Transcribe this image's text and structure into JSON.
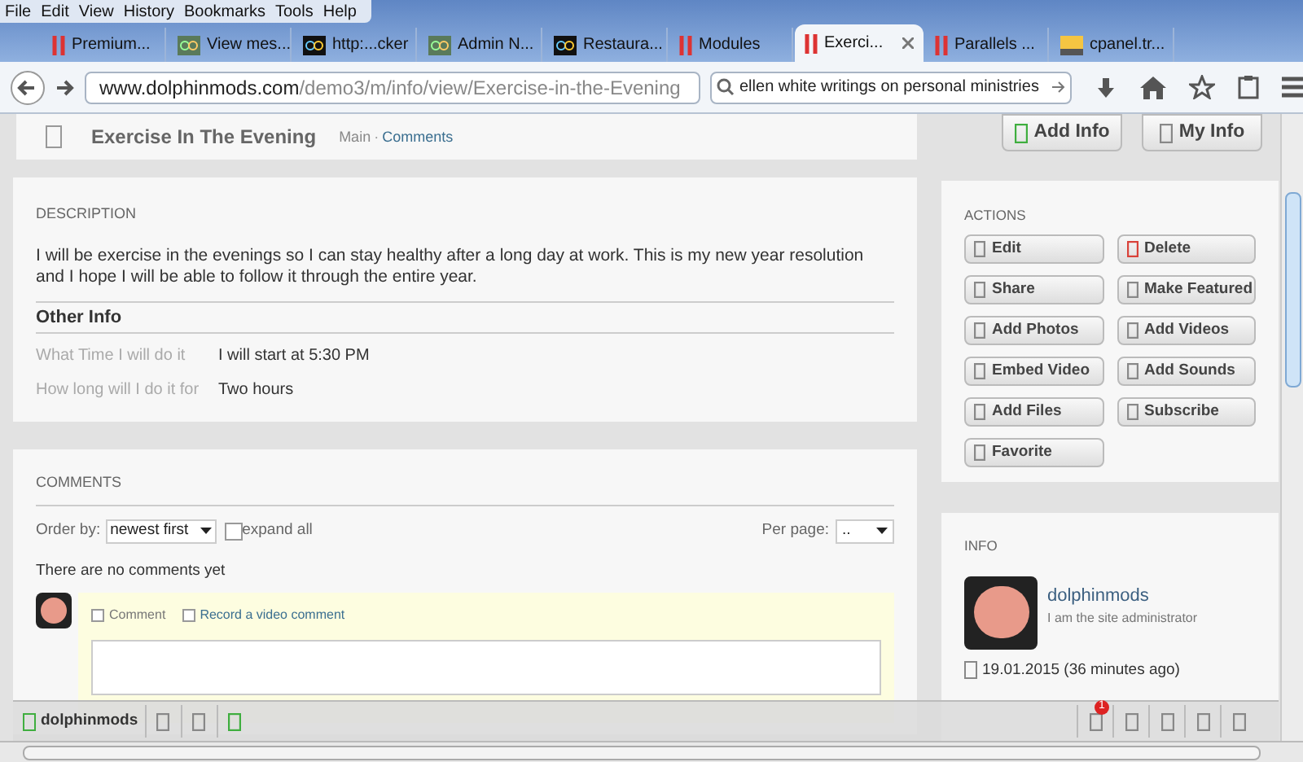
{
  "menu": [
    "File",
    "Edit",
    "View",
    "History",
    "Bookmarks",
    "Tools",
    "Help"
  ],
  "tabs": [
    {
      "label": "Premium...",
      "selected": false,
      "kind": "bars"
    },
    {
      "label": "View mes...",
      "selected": false,
      "kind": "loop"
    },
    {
      "label": "http:...cker",
      "selected": false,
      "kind": "loop-dark"
    },
    {
      "label": "Admin N...",
      "selected": false,
      "kind": "loop"
    },
    {
      "label": "Restaura...",
      "selected": false,
      "kind": "loop-dark"
    },
    {
      "label": "Modules",
      "selected": false,
      "kind": "bars"
    },
    {
      "label": "Exerci...",
      "selected": true,
      "kind": "bars"
    },
    {
      "label": "Parallels ...",
      "selected": false,
      "kind": "bars"
    },
    {
      "label": "cpanel.tr...",
      "selected": false,
      "kind": "cpanel"
    }
  ],
  "address": {
    "host": "www.dolphinmods.com",
    "path": "/demo3/m/info/view/Exercise-in-the-Evening"
  },
  "search": {
    "value": "ellen white writings on personal ministries"
  },
  "page_header": {
    "title": "Exercise In The Evening",
    "separator": "·",
    "breadcrumb": [
      {
        "label": "Main",
        "link": false
      },
      {
        "label": "Comments",
        "link": true
      }
    ],
    "buttons": [
      {
        "label": "Add Info",
        "color": "#3fae3f"
      },
      {
        "label": "My Info",
        "color": "#888888"
      }
    ]
  },
  "description": {
    "heading": "DESCRIPTION",
    "text": "I will be exercise in the evenings so I can stay healthy after a long day at work. This is my new year resolution and I hope I will be able to follow it through the entire year.",
    "other_info_heading": "Other Info",
    "fields": [
      {
        "label": "What Time I will do it",
        "value": "I will start at 5:30 PM"
      },
      {
        "label": "How long will I do it for",
        "value": "Two hours"
      }
    ]
  },
  "actions": {
    "heading": "ACTIONS",
    "buttons": [
      {
        "label": "Edit",
        "color": "#888888"
      },
      {
        "label": "Delete",
        "color": "#d9423a"
      },
      {
        "label": "Share",
        "color": "#888888"
      },
      {
        "label": "Make Featured",
        "color": "#888888"
      },
      {
        "label": "Add Photos",
        "color": "#888888"
      },
      {
        "label": "Add Videos",
        "color": "#888888"
      },
      {
        "label": "Embed Video",
        "color": "#888888"
      },
      {
        "label": "Add Sounds",
        "color": "#888888"
      },
      {
        "label": "Add Files",
        "color": "#888888"
      },
      {
        "label": "Subscribe",
        "color": "#888888"
      },
      {
        "label": "Favorite",
        "color": "#888888"
      }
    ]
  },
  "comments": {
    "heading": "COMMENTS",
    "order_label": "Order by:",
    "order_value": "newest first",
    "expand_label": "expand all",
    "expand_checked": false,
    "per_page_label": "Per page:",
    "per_page_value": "..",
    "empty_text": "There are no comments yet",
    "options": [
      {
        "label": "Comment",
        "checked": false,
        "link": false
      },
      {
        "label": "Record a video comment",
        "checked": false,
        "link": true
      }
    ]
  },
  "info": {
    "heading": "INFO",
    "name": "dolphinmods",
    "tagline": "I am the site administrator",
    "date": "19.01.2015 (36 minutes ago)"
  },
  "bottom_toolbar": {
    "user": "dolphinmods",
    "left_icons": [
      {
        "color": "#888888"
      },
      {
        "color": "#888888"
      },
      {
        "color": "#3fae3f"
      }
    ],
    "notification_badge": "1"
  }
}
